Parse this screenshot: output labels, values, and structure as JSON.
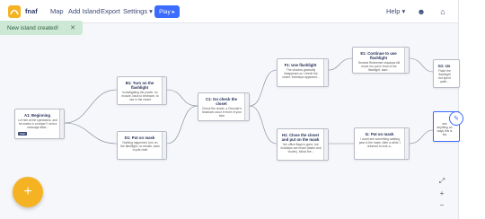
{
  "header": {
    "brand": "fnaf",
    "menu": [
      "Map",
      "Add Island",
      "Export",
      "Settings ▾"
    ],
    "play": "Play ▸",
    "help": "Help ▾",
    "profile_icon": "user-circle-icon",
    "home_icon": "home-icon"
  },
  "toast": {
    "message": "New island created!",
    "close": "✕"
  },
  "nodes": {
    "a1": {
      "title": "A1: Beginning",
      "text": "Let him at the spectators, and he marks in a helper! I sent a message alkia...",
      "tag": "Start"
    },
    "b1": {
      "title": "B1: Turn on the flashlight",
      "text": "Investigating the power, no muscle, back to bedroom, to see in the closet"
    },
    "d1": {
      "title": "D1: Put on mask",
      "text": "Nothing happened, turn on the flashlight, no results, back to pile cloth"
    },
    "c1": {
      "title": "C1: Go check the closet",
      "text": "Check the closet, a Chunder's shadows occur in front of your face"
    },
    "f1": {
      "title": "F1: Use flashlight",
      "text": "The shadow gradually disappears so I check the closet, footsteps appeared..."
    },
    "h1": {
      "title": "H1: Close the closet and put on the mask",
      "text": "the office flags is gone, but footsteps are heard (faster and louder), follow the..."
    },
    "e1": {
      "title": "E1: Continue to use flashlight",
      "text": "Several Redeemer shadows kill move run put in front of the flashlight, start..."
    },
    "i1": {
      "title": "I1: Put on mask",
      "text": "I could see something walking past in the mask. After a while, I returned to look a..."
    },
    "g1": {
      "title": "G1: Us",
      "text": "Flash the flashlight but spent quite..."
    },
    "j1": {
      "title": "",
      "text": "see anything on ways this is the"
    }
  },
  "controls": {
    "fit": "⤢",
    "zoom_in": "+",
    "zoom_out": "−",
    "add": "+"
  },
  "colors": {
    "accent": "#3b6bff",
    "fab": "#f5b324",
    "toast_bg": "#cde9d6"
  }
}
